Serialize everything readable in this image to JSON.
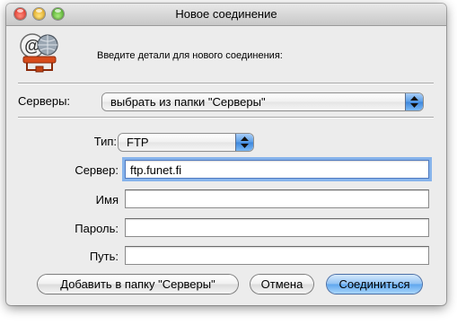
{
  "window": {
    "title": "Новое соединение"
  },
  "header": {
    "icon": "at-sign-globe-network-icon",
    "prompt": "Введите детали для нового соединения:"
  },
  "servers": {
    "label": "Серверы:",
    "selected": "выбрать из папки \"Серверы\""
  },
  "form": {
    "type_label": "Тип:",
    "type_value": "FTP",
    "server_label": "Сервер:",
    "server_value": "ftp.funet.fi",
    "name_label": "Имя",
    "name_value": "",
    "password_label": "Пароль:",
    "password_value": "",
    "path_label": "Путь:",
    "path_value": ""
  },
  "buttons": {
    "add_to_servers": "Добавить в папку \"Серверы\"",
    "cancel": "Отмена",
    "connect": "Соединиться"
  },
  "colors": {
    "window_bg": "#ececec",
    "accent_blue": "#5ea5ee",
    "close": "#d9261c",
    "minimize": "#d99c12",
    "maximize": "#3d9a1c"
  }
}
